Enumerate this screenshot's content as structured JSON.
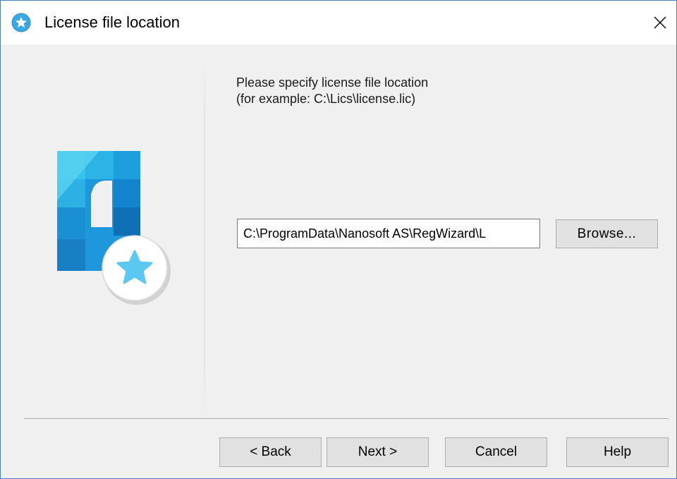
{
  "window": {
    "title": "License file location",
    "close_label": "×"
  },
  "instructions": {
    "line1": "Please specify license file location",
    "line2": "(for example: C:\\Lics\\license.lic)"
  },
  "license_path": {
    "value": "C:\\ProgramData\\Nanosoft AS\\RegWizard\\L"
  },
  "buttons": {
    "browse": "Browse...",
    "back": "< Back",
    "next": "Next >",
    "cancel": "Cancel",
    "help": "Help"
  },
  "colors": {
    "window_border": "#4a7fbf",
    "dialog_bg": "#f0f0f0",
    "button_bg": "#e1e1e1",
    "icon_blue": "#1e9be0",
    "icon_star": "#5ac8f0"
  },
  "icons": {
    "title": "app-star-icon",
    "logo": "license-star-logo",
    "close": "close-icon"
  }
}
